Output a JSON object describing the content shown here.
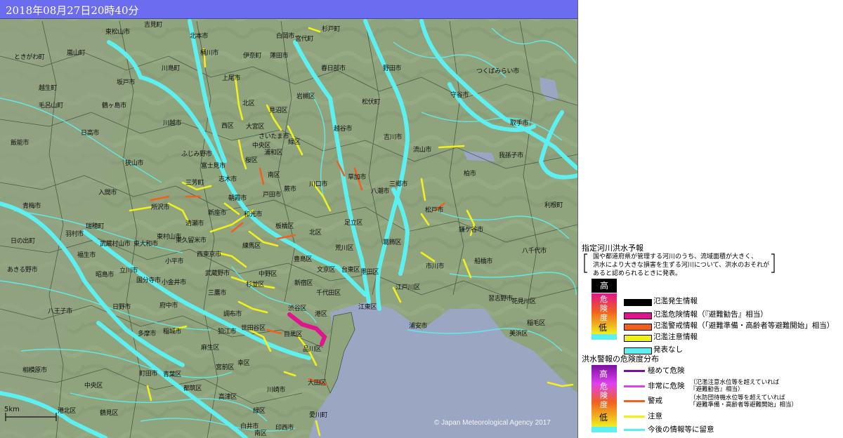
{
  "title": "2018年08月27日20時40分",
  "copyright": "© Japan Meteorological Agency 2017",
  "scale_label": "5km",
  "colors": {
    "terrain": "#8fa37d",
    "river_base": "#5ef0f0",
    "sea": "#9aa6c2",
    "boundary": "#3b4a3b",
    "title_bar": "#6c6cf0"
  },
  "place_names": [
    "東松山市",
    "吉見町",
    "北本市",
    "白岡市",
    "宮代町",
    "杉戸町",
    "ときがわ町",
    "嵐山町",
    "桶川市",
    "伊奈町",
    "蓮田市",
    "川島町",
    "越生町",
    "坂戸市",
    "上尾市",
    "春日部市",
    "野田市",
    "つくばみらい市",
    "毛呂山町",
    "鶴ヶ島市",
    "北区",
    "岩槻区",
    "見沼区",
    "松伏町",
    "守谷市",
    "日高市",
    "川越市",
    "西区",
    "大宮区",
    "さいたま市",
    "中央区",
    "越谷市",
    "吉川市",
    "取手市",
    "飯能市",
    "ふじみ野市",
    "桜区",
    "浦和区",
    "緑区",
    "流山市",
    "我孫子市",
    "狭山市",
    "富士見市",
    "南区",
    "草加市",
    "三郷市",
    "柏市",
    "入間市",
    "三芳町",
    "志木市",
    "朝霞市",
    "戸田市",
    "蕨市",
    "川口市",
    "八潮市",
    "所沢市",
    "新座市",
    "和光市",
    "板橋区",
    "足立区",
    "松戸市",
    "鎌ケ谷市",
    "青梅市",
    "羽村市",
    "瑞穂町",
    "清瀬市",
    "武蔵村山市",
    "東大和市",
    "東村山市",
    "東久留米市",
    "練馬区",
    "北区",
    "荒川区",
    "葛飾区",
    "日の出町",
    "福生市",
    "西東京市",
    "豊島区",
    "市川市",
    "船橋市",
    "八千代市",
    "あきる野市",
    "昭島市",
    "立川市",
    "小平市",
    "武蔵野市",
    "中野区",
    "文京区",
    "台東区",
    "墨田区",
    "国分寺市",
    "小金井市",
    "杉並区",
    "新宿区",
    "千代田区",
    "江戸川区",
    "習志野市",
    "八王子市",
    "日野市",
    "府中市",
    "三鷹市",
    "調布市",
    "渋谷区",
    "港区",
    "江東区",
    "浦安市",
    "花見川区",
    "多摩市",
    "稲城市",
    "狛江市",
    "世田谷区",
    "目黒区",
    "品川区",
    "美浜区",
    "稲毛区",
    "麻生区",
    "宮前区",
    "大田区",
    "相模原市",
    "中央区",
    "町田市",
    "青葉区",
    "都筑区",
    "高津区",
    "幸区",
    "川崎市",
    "緑区",
    "愛川町",
    "南区",
    "港北区",
    "鶴見区",
    "白井市",
    "印西市",
    "利根町"
  ],
  "legend": {
    "flood_forecast": {
      "title": "指定河川洪水予報",
      "description": [
        "国や都道府県が管理する河川のうち、流域面積が大きく、",
        "洪水により大きな損害を生ずる河川について、洪水のおそれが",
        "あると認められるときに発表。"
      ],
      "scale_high": "高",
      "scale_mid": [
        "危",
        "険",
        "度"
      ],
      "scale_low": "低",
      "items": [
        {
          "label": "氾濫発生情報",
          "color": "#000000"
        },
        {
          "label": "氾濫危険情報（『避難勧告』相当）",
          "color": "#e0148c"
        },
        {
          "label": "氾濫警戒情報（「避難準備・高齢者等避難開始」相当）",
          "color": "#f06020"
        },
        {
          "label": "氾濫注意情報",
          "color": "#f0f020"
        },
        {
          "label": "発表なし",
          "color": "#5ef0f0"
        }
      ]
    },
    "hazard_distribution": {
      "title": "洪水警報の危険度分布",
      "scale_high": "高",
      "scale_mid": [
        "危",
        "険",
        "度"
      ],
      "scale_low": "低",
      "items": [
        {
          "label": "極めて危険",
          "color": "#7a10a0"
        },
        {
          "label": "非常に危険",
          "color": "#e040f0"
        },
        {
          "label": "警戒",
          "color": "#f06020"
        },
        {
          "label": "注意",
          "color": "#f0f020"
        },
        {
          "label": "今後の情報等に留意",
          "color": "#5ef0f0"
        }
      ],
      "notes": [
        [
          "（氾濫注意水位等を超えていれば",
          "『避難勧告』相当）"
        ],
        [
          "（水防団待機水位等を超えていれば",
          "「避難準備・高齢者等避難開始」相当）"
        ]
      ]
    }
  }
}
